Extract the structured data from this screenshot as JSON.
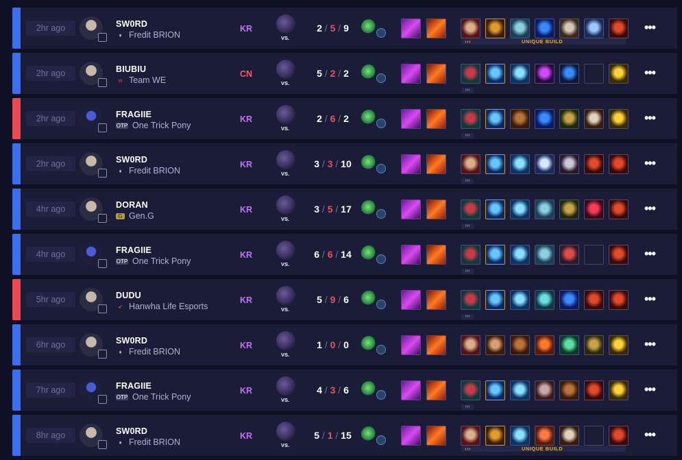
{
  "colors": {
    "win": "#3b6ef1",
    "loss": "#ee4a55",
    "kr": "#c96bff",
    "cn": "#ff5b5b",
    "deaths": "#ef4f58",
    "unique": "#e0ad48"
  },
  "unique_build_label": "UNIQUE BUILD",
  "unique_build_arrows": "›››",
  "expand_arrows": "›››",
  "vs_label": "VS.",
  "more_label": "•••",
  "matches": [
    {
      "result": "win",
      "time": "2hr ago",
      "player": "SW0RD",
      "team": "Fredit BRION",
      "team_logo": "brion",
      "region": "KR",
      "kills": "2",
      "deaths": "5",
      "assists": "9",
      "unique": true,
      "expand": false,
      "items": [
        [
          "#5b1216",
          "#d8b08a"
        ],
        [
          "#3a1c08",
          "#e29a2a"
        ],
        [
          "#1a4057",
          "#8ad0e0"
        ],
        [
          "#0a1a66",
          "#3a8bff"
        ],
        [
          "#3b2a1a",
          "#d6c7b8"
        ],
        [
          "#1a2a5a",
          "#9ac8ff"
        ],
        [
          "#3a0a0a",
          "#e24a2a"
        ]
      ],
      "mythic": [
        1
      ]
    },
    {
      "result": "win",
      "time": "2hr ago",
      "player": "BIUBIU",
      "team": "Team WE",
      "team_logo": "we",
      "region": "CN",
      "kills": "5",
      "deaths": "2",
      "assists": "2",
      "unique": false,
      "expand": true,
      "items": [
        [
          "#0d3a3a",
          "#c8394a"
        ],
        [
          "#0a2a66",
          "#66c6ff"
        ],
        [
          "#0a3466",
          "#8ae0ff"
        ],
        [
          "#2a0a3a",
          "#d04aff"
        ],
        [
          "#0a1a3a",
          "#3a8bff"
        ],
        null,
        [
          "#3a2a00",
          "#ffd23a"
        ]
      ],
      "mythic": [
        1
      ]
    },
    {
      "result": "loss",
      "time": "2hr ago",
      "player": "FRAGIIE",
      "team": "One Trick Pony",
      "team_logo": "otp",
      "region": "KR",
      "kills": "2",
      "deaths": "6",
      "assists": "2",
      "unique": false,
      "expand": true,
      "items": [
        [
          "#0d3a3a",
          "#c8394a"
        ],
        [
          "#0a2a66",
          "#66c6ff"
        ],
        [
          "#3a1a08",
          "#b8743a"
        ],
        [
          "#0a1a66",
          "#3a8bff"
        ],
        [
          "#1a2a0a",
          "#c8a24a"
        ],
        [
          "#3a1a0a",
          "#e0d0c0"
        ],
        [
          "#3a2a00",
          "#ffd23a"
        ]
      ],
      "mythic": [
        1
      ]
    },
    {
      "result": "win",
      "time": "2hr ago",
      "player": "SW0RD",
      "team": "Fredit BRION",
      "team_logo": "brion",
      "region": "KR",
      "kills": "3",
      "deaths": "3",
      "assists": "10",
      "unique": false,
      "expand": true,
      "items": [
        [
          "#5b1216",
          "#d8b08a"
        ],
        [
          "#0a2a66",
          "#66c6ff"
        ],
        [
          "#0a3466",
          "#8ae0ff"
        ],
        [
          "#1a2a5a",
          "#d8e8ff"
        ],
        [
          "#2a1a2a",
          "#c8c8d8"
        ],
        [
          "#3a0a0a",
          "#e24a2a"
        ],
        [
          "#3a0a0a",
          "#e24a2a"
        ]
      ],
      "mythic": [
        1
      ]
    },
    {
      "result": "win",
      "time": "4hr ago",
      "player": "DORAN",
      "team": "Gen.G",
      "team_logo": "geng",
      "region": "KR",
      "kills": "3",
      "deaths": "5",
      "assists": "17",
      "unique": false,
      "expand": true,
      "items": [
        [
          "#0d3a3a",
          "#c8394a"
        ],
        [
          "#0a2a66",
          "#66c6ff"
        ],
        [
          "#0a3466",
          "#8ae0ff"
        ],
        [
          "#1a4057",
          "#8ad0e0"
        ],
        [
          "#1a2a0a",
          "#c8a24a"
        ],
        [
          "#3a0a14",
          "#ff3a5a"
        ],
        [
          "#3a0a0a",
          "#e24a2a"
        ]
      ],
      "mythic": [
        1
      ]
    },
    {
      "result": "win",
      "time": "4hr ago",
      "player": "FRAGIIE",
      "team": "One Trick Pony",
      "team_logo": "otp",
      "region": "KR",
      "kills": "6",
      "deaths": "6",
      "assists": "14",
      "unique": false,
      "expand": true,
      "items": [
        [
          "#0d3a3a",
          "#c8394a"
        ],
        [
          "#0a2a66",
          "#66c6ff"
        ],
        [
          "#0a3466",
          "#8ae0ff"
        ],
        [
          "#1a4057",
          "#8ad0e0"
        ],
        [
          "#2a1a2a",
          "#e04a4a"
        ],
        null,
        [
          "#3a0a0a",
          "#e24a2a"
        ]
      ],
      "mythic": [
        1
      ]
    },
    {
      "result": "loss",
      "time": "5hr ago",
      "player": "DUDU",
      "team": "Hanwha Life Esports",
      "team_logo": "hle",
      "region": "KR",
      "kills": "5",
      "deaths": "9",
      "assists": "6",
      "unique": false,
      "expand": true,
      "items": [
        [
          "#0d3a3a",
          "#c8394a"
        ],
        [
          "#0a2a66",
          "#66c6ff"
        ],
        [
          "#0a3466",
          "#8ae0ff"
        ],
        [
          "#0a3a4a",
          "#6ae0e0"
        ],
        [
          "#0a1a66",
          "#3a8bff"
        ],
        [
          "#3a0a0a",
          "#e24a2a"
        ],
        [
          "#3a0a0a",
          "#e24a2a"
        ]
      ],
      "mythic": [
        1
      ]
    },
    {
      "result": "win",
      "time": "6hr ago",
      "player": "SW0RD",
      "team": "Fredit BRION",
      "team_logo": "brion",
      "region": "KR",
      "kills": "1",
      "deaths": "0",
      "assists": "0",
      "unique": false,
      "expand": false,
      "items": [
        [
          "#5b1216",
          "#d8b08a"
        ],
        [
          "#3a1a08",
          "#d8a070"
        ],
        [
          "#3a1a08",
          "#b8743a"
        ],
        [
          "#5a1a0a",
          "#ff7a2a"
        ],
        [
          "#0a3a2a",
          "#5ae0a0"
        ],
        [
          "#2a2a0a",
          "#c8a24a"
        ],
        [
          "#3a2a00",
          "#ffd23a"
        ]
      ],
      "mythic": []
    },
    {
      "result": "win",
      "time": "7hr ago",
      "player": "FRAGIIE",
      "team": "One Trick Pony",
      "team_logo": "otp",
      "region": "KR",
      "kills": "4",
      "deaths": "3",
      "assists": "6",
      "unique": false,
      "expand": true,
      "items": [
        [
          "#0d3a3a",
          "#c8394a"
        ],
        [
          "#0a2a66",
          "#66c6ff"
        ],
        [
          "#0a3466",
          "#8ae0ff"
        ],
        [
          "#3a1a1a",
          "#c8a8a8"
        ],
        [
          "#3a1a08",
          "#b8743a"
        ],
        [
          "#3a0a0a",
          "#e24a2a"
        ],
        [
          "#3a2a00",
          "#ffd23a"
        ]
      ],
      "mythic": [
        1
      ]
    },
    {
      "result": "win",
      "time": "8hr ago",
      "player": "SW0RD",
      "team": "Fredit BRION",
      "team_logo": "brion",
      "region": "KR",
      "kills": "5",
      "deaths": "1",
      "assists": "15",
      "unique": true,
      "expand": false,
      "items": [
        [
          "#5b1216",
          "#d8b08a"
        ],
        [
          "#3a1c08",
          "#e29a2a"
        ],
        [
          "#0a3466",
          "#8ae0ff"
        ],
        [
          "#5a1a0a",
          "#ff7a4a"
        ],
        [
          "#3a1a08",
          "#e0d0c0"
        ],
        null,
        [
          "#3a0a0a",
          "#e24a2a"
        ]
      ],
      "mythic": [
        1
      ]
    }
  ]
}
